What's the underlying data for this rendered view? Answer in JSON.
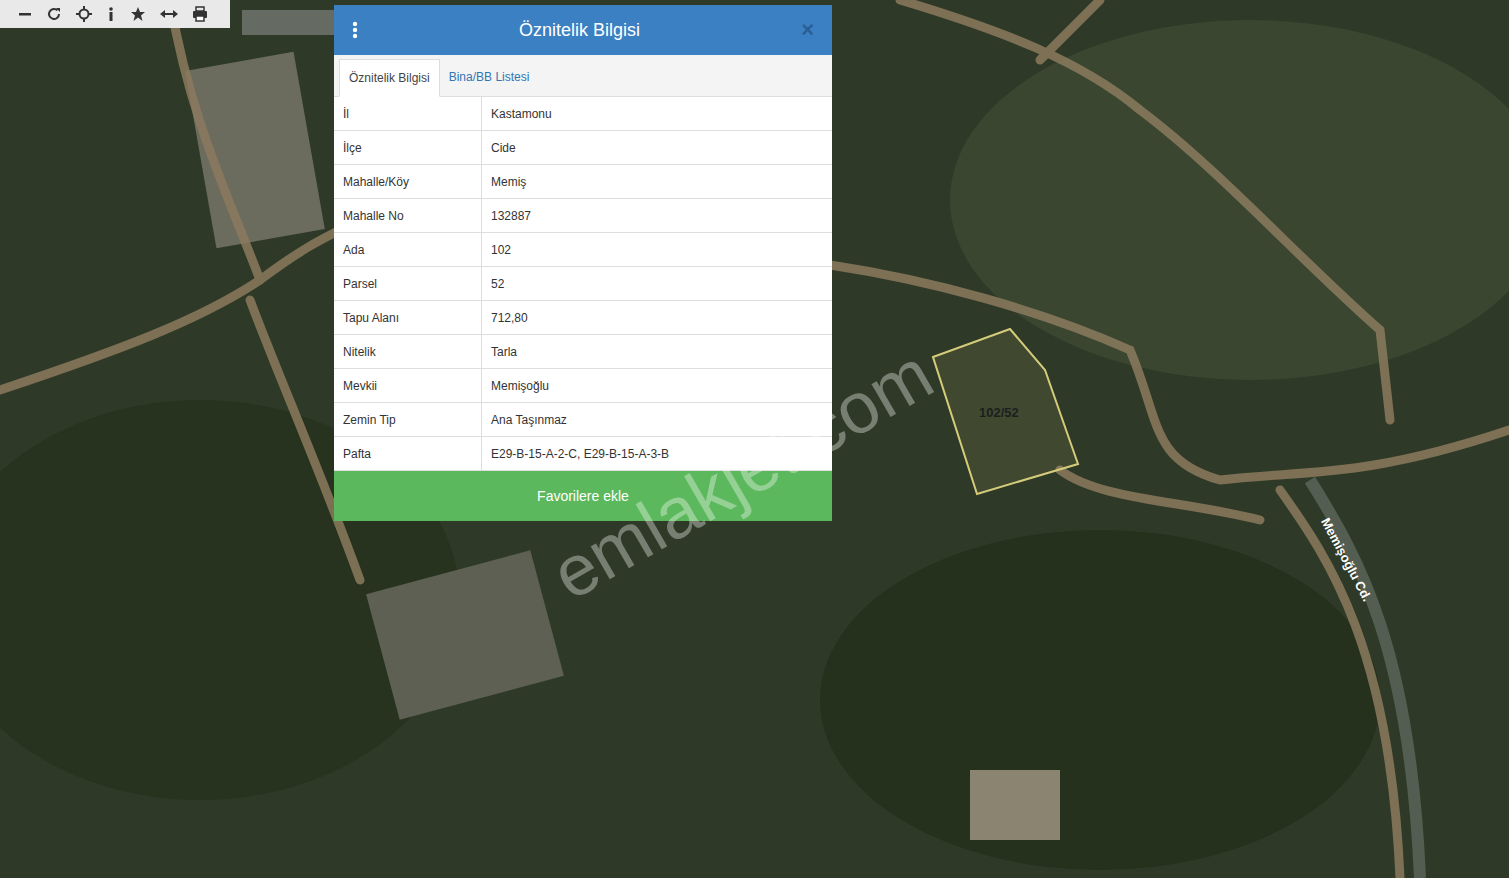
{
  "map": {
    "parcel_label": "102/52",
    "road_label": "Memişoğlu Cd.",
    "watermark": "emlakjet.com"
  },
  "popup": {
    "title": "Öznitelik Bilgisi",
    "close": "×",
    "tabs": [
      {
        "label": "Öznitelik Bilgisi",
        "selected": true
      },
      {
        "label": "Bina/BB Listesi",
        "selected": false
      }
    ],
    "rows": [
      [
        "İl",
        "Kastamonu"
      ],
      [
        "İlçe",
        "Cide"
      ],
      [
        "Mahalle/Köy",
        "Memiş"
      ],
      [
        "Mahalle No",
        "132887"
      ],
      [
        "Ada",
        "102"
      ],
      [
        "Parsel",
        "52"
      ],
      [
        "Tapu Alanı",
        "712,80"
      ],
      [
        "Nitelik",
        "Tarla"
      ],
      [
        "Mevkii",
        "Memişoğlu"
      ],
      [
        "Zemin Tip",
        "Ana Taşınmaz"
      ],
      [
        "Pafta",
        "E29-B-15-A-2-C, E29-B-15-A-3-B"
      ]
    ],
    "button": "Favorilere ekle"
  }
}
